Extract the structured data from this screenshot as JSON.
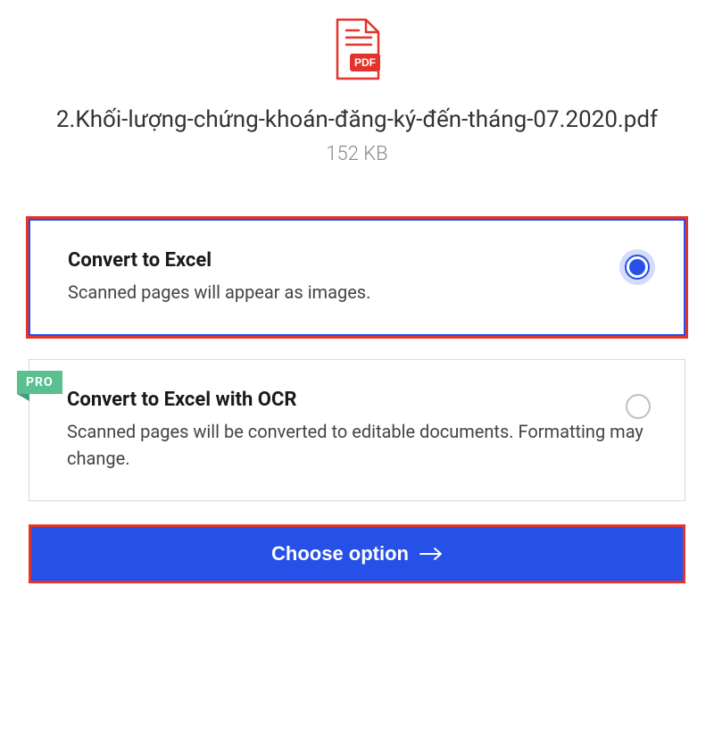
{
  "file": {
    "name": "2.Khối-lượng-chứng-khoán-đăng-ký-đến-tháng-07.2020.pdf",
    "size": "152 KB",
    "icon_badge": "PDF"
  },
  "options": [
    {
      "title": "Convert to Excel",
      "desc": "Scanned pages will appear as images.",
      "selected": true,
      "has_pro": false
    },
    {
      "title": "Convert to Excel with OCR",
      "desc": "Scanned pages will be converted to editable documents. Formatting may change.",
      "selected": false,
      "has_pro": true,
      "pro_label": "PRO"
    }
  ],
  "action": {
    "label": "Choose option"
  },
  "colors": {
    "primary": "#2650e8",
    "highlight_border": "#e4332a",
    "pro_badge": "#5ac08f"
  }
}
